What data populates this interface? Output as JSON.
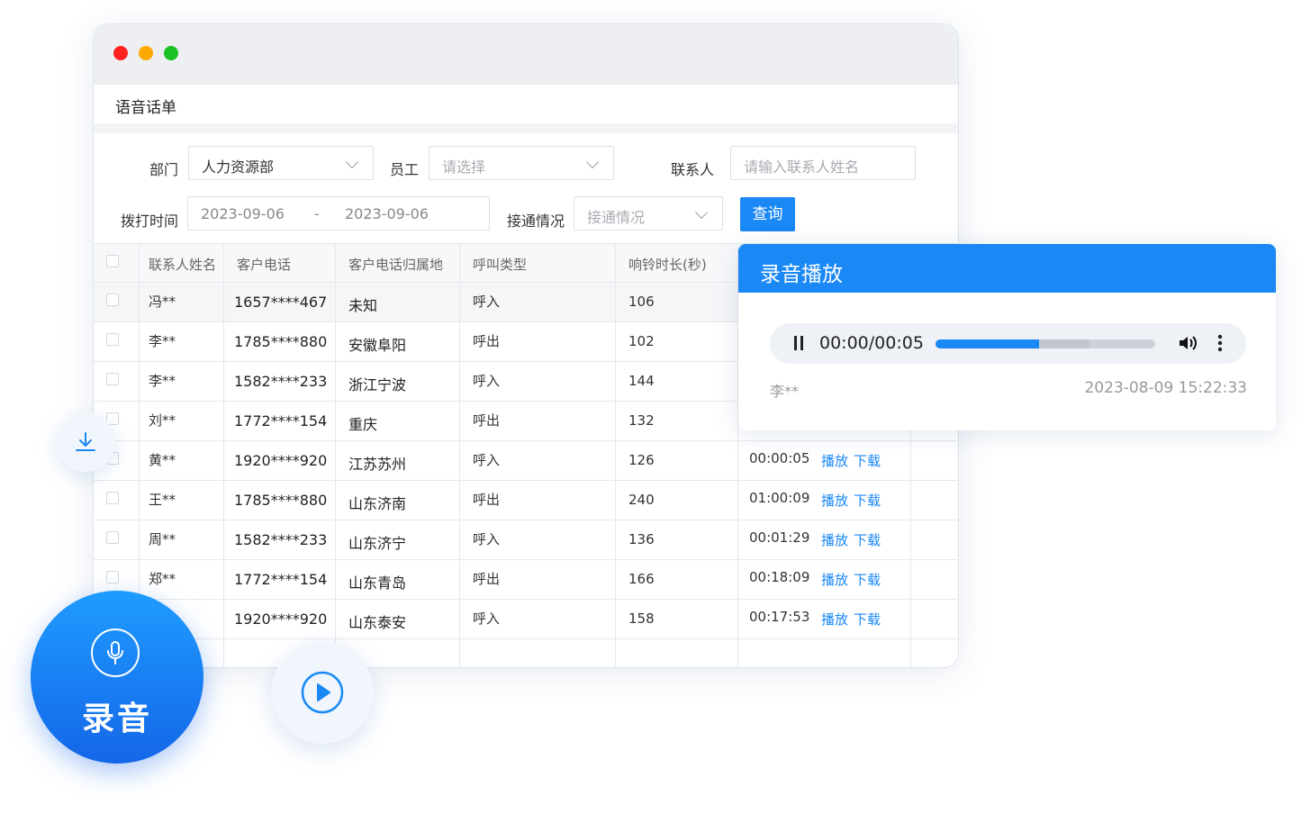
{
  "window": {
    "section_title": "语音话单"
  },
  "filters": {
    "department_label": "部门",
    "department_value": "人力资源部",
    "employee_label": "员工",
    "employee_placeholder": "请选择",
    "contact_label": "联系人",
    "contact_placeholder": "请输入联系人姓名",
    "time_label": "拨打时间",
    "date_start": "2023-09-06",
    "date_sep": "-",
    "date_end": "2023-09-06",
    "status_label": "接通情况",
    "status_placeholder": "接通情况",
    "query_label": "查询"
  },
  "table": {
    "columns": [
      "联系人姓名",
      "客户电话",
      "客户电话归属地",
      "呼叫类型",
      "响铃时长(秒)"
    ],
    "rows": [
      {
        "name": "冯**",
        "phone": "1657****467",
        "location": "未知",
        "type": "呼入",
        "ring": "106",
        "duration": "",
        "play": "",
        "download": ""
      },
      {
        "name": "李**",
        "phone": "1785****880",
        "location": "安徽阜阳",
        "type": "呼出",
        "ring": "102",
        "duration": "",
        "play": "",
        "download": ""
      },
      {
        "name": "李**",
        "phone": "1582****233",
        "location": "浙江宁波",
        "type": "呼入",
        "ring": "144",
        "duration": "",
        "play": "",
        "download": ""
      },
      {
        "name": "刘**",
        "phone": "1772****154",
        "location": "重庆",
        "type": "呼出",
        "ring": "132",
        "duration": "",
        "play": "",
        "download": ""
      },
      {
        "name": "黄**",
        "phone": "1920****920",
        "location": "江苏苏州",
        "type": "呼入",
        "ring": "126",
        "duration": "00:00:05",
        "play": "播放",
        "download": "下载"
      },
      {
        "name": "王**",
        "phone": "1785****880",
        "location": "山东济南",
        "type": "呼出",
        "ring": "240",
        "duration": "01:00:09",
        "play": "播放",
        "download": "下载"
      },
      {
        "name": "周**",
        "phone": "1582****233",
        "location": "山东济宁",
        "type": "呼入",
        "ring": "136",
        "duration": "00:01:29",
        "play": "播放",
        "download": "下载"
      },
      {
        "name": "郑**",
        "phone": "1772****154",
        "location": "山东青岛",
        "type": "呼出",
        "ring": "166",
        "duration": "00:18:09",
        "play": "播放",
        "download": "下载"
      },
      {
        "name": "",
        "phone": "1920****920",
        "location": "山东泰安",
        "type": "呼入",
        "ring": "158",
        "duration": "00:17:53",
        "play": "播放",
        "download": "下载"
      }
    ]
  },
  "player_panel": {
    "title": "录音播放",
    "time": "00:00/00:05",
    "progress": 0.47,
    "buffered": 0.7,
    "name": "李**",
    "datetime": "2023-08-09 15:22:33"
  },
  "record_badge": {
    "label": "录音"
  },
  "icons": {
    "download": "download-icon",
    "microphone": "microphone-icon",
    "play": "play-icon",
    "volume": "volume-icon",
    "more": "more-vertical-icon"
  },
  "colors": {
    "accent": "#1a88f5",
    "close": "#fe2120",
    "minimize": "#fdaa00",
    "maximize": "#18c222"
  }
}
